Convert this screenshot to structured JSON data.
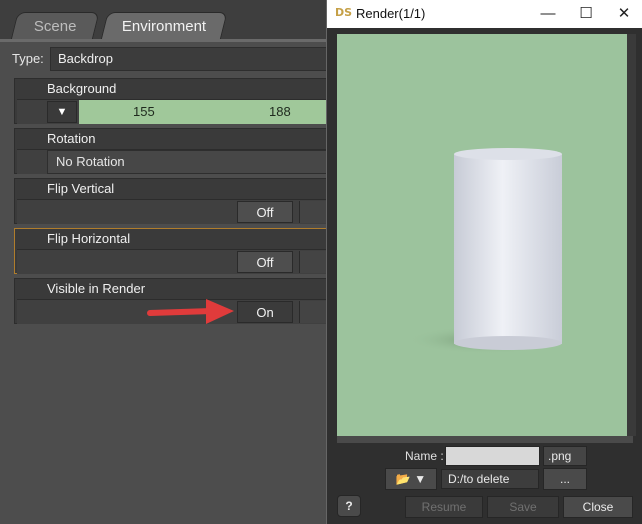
{
  "left_pane": {
    "tabs": [
      {
        "label": "Scene",
        "active": false
      },
      {
        "label": "Environment",
        "active": true
      }
    ],
    "type_label": "Type:",
    "type_value": "Backdrop",
    "properties": {
      "background": {
        "label": "Background",
        "values": [
          "155",
          "188"
        ],
        "color": "#a0c89a"
      },
      "rotation": {
        "label": "Rotation",
        "value": "No Rotation"
      },
      "flip_vertical": {
        "label": "Flip Vertical",
        "value": "Off"
      },
      "flip_horizontal": {
        "label": "Flip Horizontal",
        "value": "Off"
      },
      "visible_in_render": {
        "label": "Visible in Render",
        "value": "On"
      }
    }
  },
  "render_window": {
    "icon": "DS",
    "title": "Render(1/1)",
    "controls": [
      "minimize-icon",
      "maximize-icon",
      "close-icon"
    ],
    "name_label": "Name :",
    "name_value": "",
    "format": ".png ▼",
    "path": "D:/to delete",
    "browse_label": "...",
    "buttons": {
      "help": "?",
      "resume": "Resume",
      "save": "Save",
      "close": "Close"
    }
  }
}
